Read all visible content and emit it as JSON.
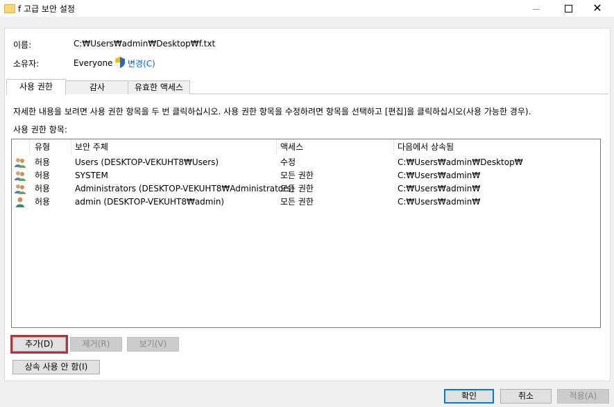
{
  "window": {
    "title": "f 고급 보안 설정",
    "close_glyph": "✕"
  },
  "info": {
    "name_label": "이름:",
    "name_value": "C:₩Users₩admin₩Desktop₩f.txt",
    "owner_label": "소유자:",
    "owner_value": "Everyone",
    "change_link": "변경(C)"
  },
  "tabs": [
    {
      "label": "사용 권한",
      "active": true
    },
    {
      "label": "감사",
      "active": false
    },
    {
      "label": "유효한 액세스",
      "active": false
    }
  ],
  "instructions": "자세한 내용을 보려면 사용 권한 항목을 두 번 클릭하십시오. 사용 권한 항목을 수정하려면 항목을 선택하고 [편집]을 클릭하십시오(사용 가능한 경우).",
  "entries_label": "사용 권한 항목:",
  "table": {
    "columns": [
      "유형",
      "보안 주체",
      "액세스",
      "다음에서 상속됨"
    ],
    "rows": [
      {
        "icon": "group-users-icon",
        "type": "허용",
        "principal": "Users (DESKTOP-VEKUHT8₩Users)",
        "access": "수정",
        "inherited": "C:₩Users₩admin₩Desktop₩"
      },
      {
        "icon": "group-users-icon",
        "type": "허용",
        "principal": "SYSTEM",
        "access": "모든 권한",
        "inherited": "C:₩Users₩admin₩"
      },
      {
        "icon": "group-users-icon",
        "type": "허용",
        "principal": "Administrators (DESKTOP-VEKUHT8₩Administrators)",
        "access": "모든 권한",
        "inherited": "C:₩Users₩admin₩"
      },
      {
        "icon": "single-user-icon",
        "type": "허용",
        "principal": "admin (DESKTOP-VEKUHT8₩admin)",
        "access": "모든 권한",
        "inherited": "C:₩Users₩admin₩"
      }
    ]
  },
  "buttons": {
    "add": "추가(D)",
    "remove": "제거(R)",
    "view": "보기(V)",
    "disable_inheritance": "상속 사용 안 함(I)",
    "ok": "확인",
    "cancel": "취소",
    "apply": "적용(A)"
  },
  "colors": {
    "highlight": "#e0202a",
    "link": "#0066cc",
    "default_border": "#0078d7"
  }
}
